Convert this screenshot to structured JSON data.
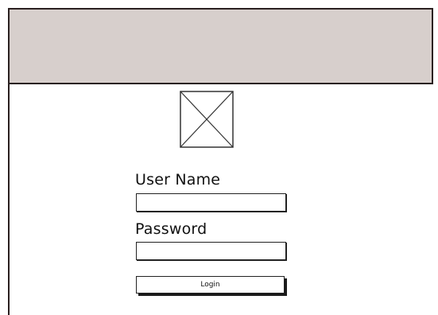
{
  "header": {
    "background": "#d7cfcc"
  },
  "logo": {
    "icon": "image-placeholder-icon"
  },
  "login_form": {
    "username_label": "User Name",
    "username_value": "",
    "password_label": "Password",
    "password_value": "",
    "login_button_label": "Login"
  }
}
